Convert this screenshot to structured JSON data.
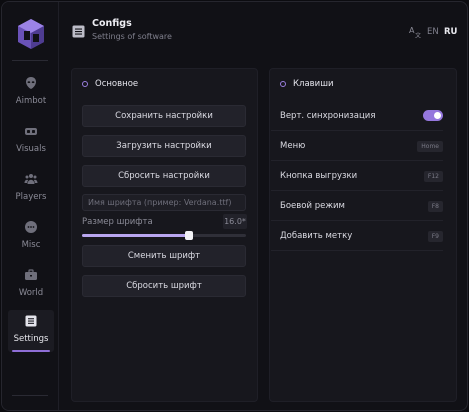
{
  "header": {
    "title": "Configs",
    "subtitle": "Settings of software",
    "languages": [
      "EN",
      "RU"
    ],
    "active_language": "RU"
  },
  "sidebar": {
    "items": [
      {
        "label": "Aimbot",
        "icon": "alien-icon"
      },
      {
        "label": "Visuals",
        "icon": "vr-glasses-icon"
      },
      {
        "label": "Players",
        "icon": "users-icon"
      },
      {
        "label": "Misc",
        "icon": "chat-dots-icon"
      },
      {
        "label": "World",
        "icon": "briefcase-icon"
      },
      {
        "label": "Settings",
        "icon": "list-icon",
        "active": true
      }
    ]
  },
  "left_panel": {
    "title": "Основное",
    "save_label": "Сохранить настройки",
    "load_label": "Загрузить настройки",
    "reset_label": "Сбросить настройки",
    "font_placeholder": "Имя шрифта (пример: Verdana.ttf)",
    "font_size_label": "Размер шрифта",
    "font_size_value": "16.0*",
    "font_size_fraction": 0.65,
    "change_font_label": "Сменить шрифт",
    "reset_font_label": "Сбросить шрифт"
  },
  "right_panel": {
    "title": "Клавиши",
    "rows": [
      {
        "label": "Верт. синхронизация",
        "type": "toggle",
        "on": true
      },
      {
        "label": "Меню",
        "type": "key",
        "key": "Home"
      },
      {
        "label": "Кнопка выгрузки",
        "type": "key",
        "key": "F12"
      },
      {
        "label": "Боевой режим",
        "type": "key",
        "key": "F8"
      },
      {
        "label": "Добавить метку",
        "type": "key",
        "key": "F9"
      }
    ]
  },
  "colors": {
    "accent": "#9577dd",
    "background": "#111116",
    "panel": "#17171d"
  }
}
